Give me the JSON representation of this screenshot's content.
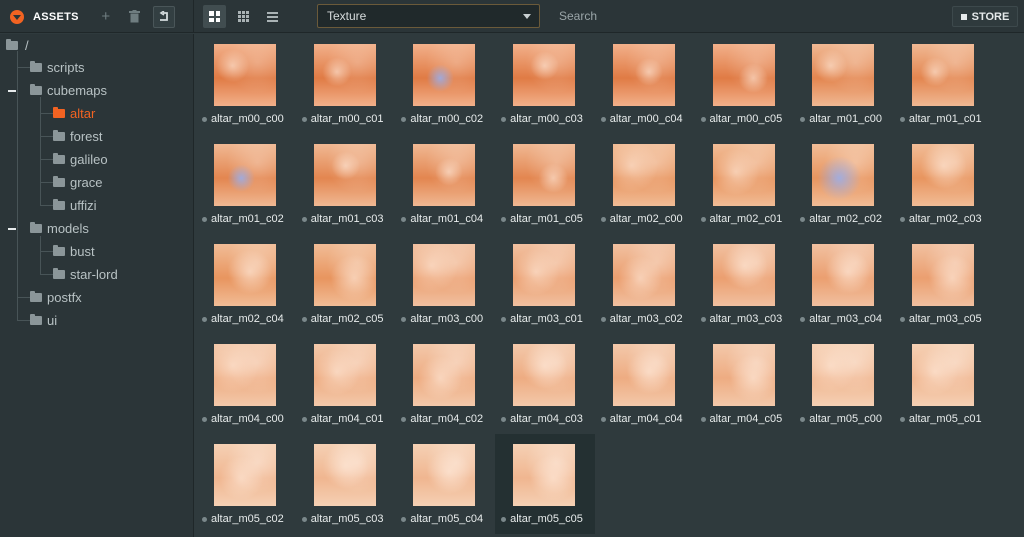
{
  "header": {
    "title": "ASSETS",
    "type_filter": "Texture",
    "search_placeholder": "Search",
    "store_label": "STORE",
    "accent": "#f26322"
  },
  "icons": {
    "menu": "dropdown-circle-icon",
    "add": "plus-icon",
    "delete": "trash-icon",
    "up": "folder-up-icon",
    "view_large": "grid-large-icon",
    "view_small": "grid-small-icon",
    "view_list": "list-icon",
    "folder": "folder-icon",
    "store": "store-icon"
  },
  "tree": {
    "root": "/",
    "scripts": "scripts",
    "cubemaps": "cubemaps",
    "altar": "altar",
    "forest": "forest",
    "galileo": "galileo",
    "grace": "grace",
    "uffizi": "uffizi",
    "models": "models",
    "bust": "bust",
    "star_lord": "star-lord",
    "postfx": "postfx",
    "ui": "ui",
    "selected": "altar"
  },
  "assets": [
    {
      "name": "altar_m00_c00"
    },
    {
      "name": "altar_m00_c01"
    },
    {
      "name": "altar_m00_c02"
    },
    {
      "name": "altar_m00_c03"
    },
    {
      "name": "altar_m00_c04"
    },
    {
      "name": "altar_m00_c05"
    },
    {
      "name": "altar_m01_c00"
    },
    {
      "name": "altar_m01_c01"
    },
    {
      "name": "altar_m01_c02"
    },
    {
      "name": "altar_m01_c03"
    },
    {
      "name": "altar_m01_c04"
    },
    {
      "name": "altar_m01_c05"
    },
    {
      "name": "altar_m02_c00"
    },
    {
      "name": "altar_m02_c01"
    },
    {
      "name": "altar_m02_c02"
    },
    {
      "name": "altar_m02_c03"
    },
    {
      "name": "altar_m02_c04"
    },
    {
      "name": "altar_m02_c05"
    },
    {
      "name": "altar_m03_c00"
    },
    {
      "name": "altar_m03_c01"
    },
    {
      "name": "altar_m03_c02"
    },
    {
      "name": "altar_m03_c03"
    },
    {
      "name": "altar_m03_c04"
    },
    {
      "name": "altar_m03_c05"
    },
    {
      "name": "altar_m04_c00"
    },
    {
      "name": "altar_m04_c01"
    },
    {
      "name": "altar_m04_c02"
    },
    {
      "name": "altar_m04_c03"
    },
    {
      "name": "altar_m04_c04"
    },
    {
      "name": "altar_m04_c05"
    },
    {
      "name": "altar_m05_c00"
    },
    {
      "name": "altar_m05_c01"
    },
    {
      "name": "altar_m05_c02"
    },
    {
      "name": "altar_m05_c03"
    },
    {
      "name": "altar_m05_c04"
    },
    {
      "name": "altar_m05_c05"
    }
  ],
  "selected_asset": "altar_m05_c05"
}
